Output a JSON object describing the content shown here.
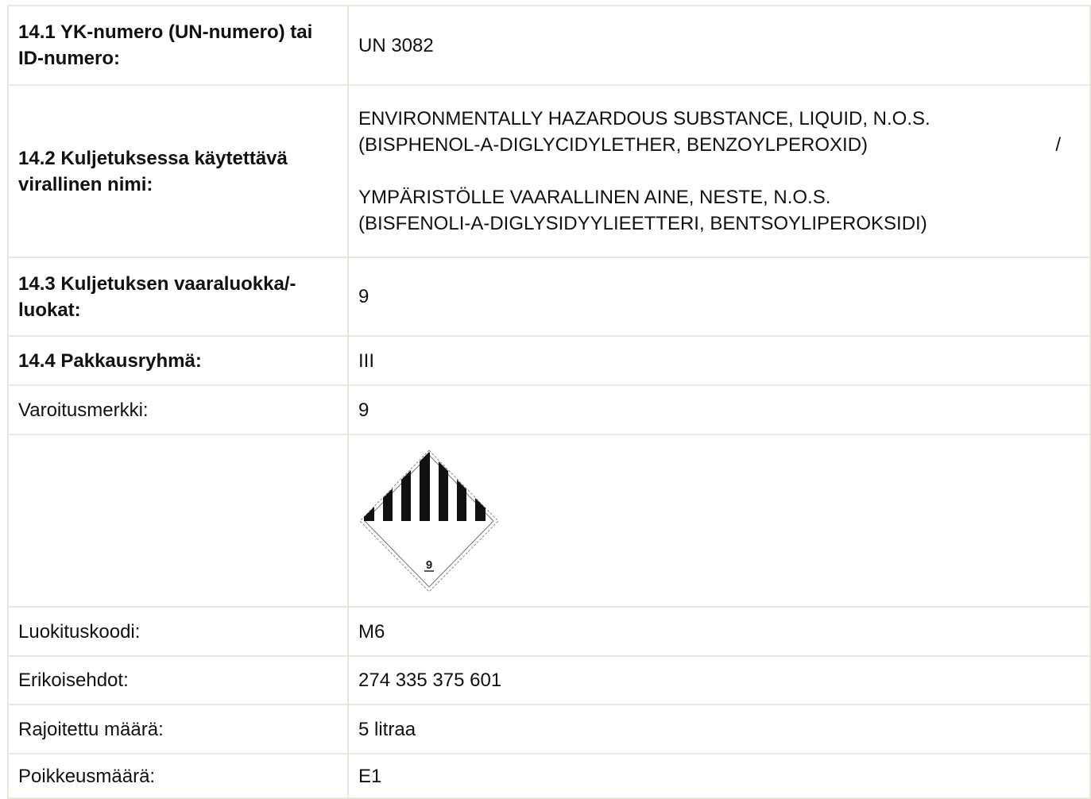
{
  "rows": [
    {
      "label": "14.1 YK-numero (UN-numero) tai ID-numero:",
      "value": "UN 3082"
    },
    {
      "label": "14.2 Kuljetuksessa käytettävä virallinen nimi:",
      "value_lines": [
        "ENVIRONMENTALLY HAZARDOUS SUBSTANCE, LIQUID, N.O.S.",
        "(BISPHENOL-A-DIGLYCIDYLETHER, BENZOYLPEROXID)",
        "/",
        "YMPÄRISTÖLLE VAARALLINEN AINE, NESTE, N.O.S.",
        "(BISFENOLI-A-DIGLYSIDYYLIEETTERI, BENTSOYLIPEROKSIDI)"
      ]
    },
    {
      "label": "14.3 Kuljetuksen vaaraluokka/-luokat:",
      "value": "9"
    },
    {
      "label": "14.4 Pakkausryhmä:",
      "value": "III"
    },
    {
      "label": "Varoitusmerkki:",
      "value": "9"
    },
    {
      "label": "",
      "pictogram": {
        "icon": "hazard-class-9-diamond-icon",
        "number": "9"
      }
    },
    {
      "label": "Luokituskoodi:",
      "value": "M6"
    },
    {
      "label": "Erikoisehdot:",
      "value": "274 335 375 601"
    },
    {
      "label": "Rajoitettu määrä:",
      "value": "5 litraa"
    },
    {
      "label": "Poikkeusmäärä:",
      "value": "E1"
    }
  ]
}
